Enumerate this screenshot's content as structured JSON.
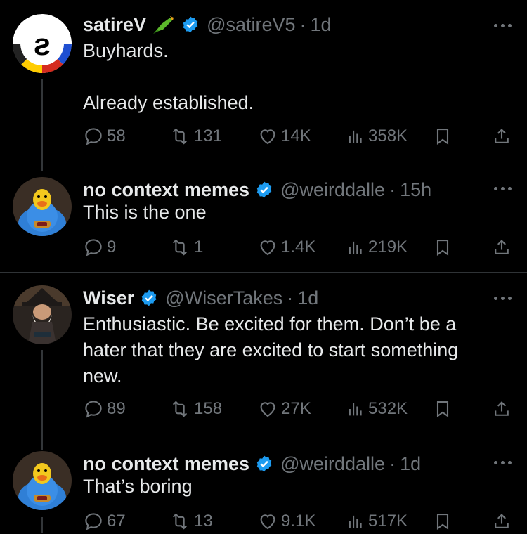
{
  "tweets": [
    {
      "name": "satireV",
      "emoji": "parrot-emoji",
      "handle": "@satireV5",
      "sep": "·",
      "time": "1d",
      "lines": [
        "Buyhards.",
        "",
        "Already established."
      ],
      "stats": {
        "replies": "58",
        "reposts": "131",
        "likes": "14K",
        "views": "358K"
      }
    },
    {
      "name": "no context memes",
      "handle": "@weirddalle",
      "sep": "·",
      "time": "15h",
      "lines": [
        "This is the one"
      ],
      "stats": {
        "replies": "9",
        "reposts": "1",
        "likes": "1.4K",
        "views": "219K"
      }
    },
    {
      "name": "Wiser",
      "handle": "@WiserTakes",
      "sep": "·",
      "time": "1d",
      "lines": [
        "Enthusiastic. Be excited for them. Don’t be a",
        "hater that they are excited to start something",
        "new."
      ],
      "stats": {
        "replies": "89",
        "reposts": "158",
        "likes": "27K",
        "views": "532K"
      }
    },
    {
      "name": "no context memes",
      "handle": "@weirddalle",
      "sep": "·",
      "time": "1d",
      "lines": [
        "That’s boring"
      ],
      "stats": {
        "replies": "67",
        "reposts": "13",
        "likes": "9.1K",
        "views": "517K"
      }
    }
  ],
  "colors": {
    "background": "#000000",
    "text": "#e7e9ea",
    "muted": "#71767b",
    "verified": "#1d9bf0",
    "thread_line": "#333639"
  }
}
